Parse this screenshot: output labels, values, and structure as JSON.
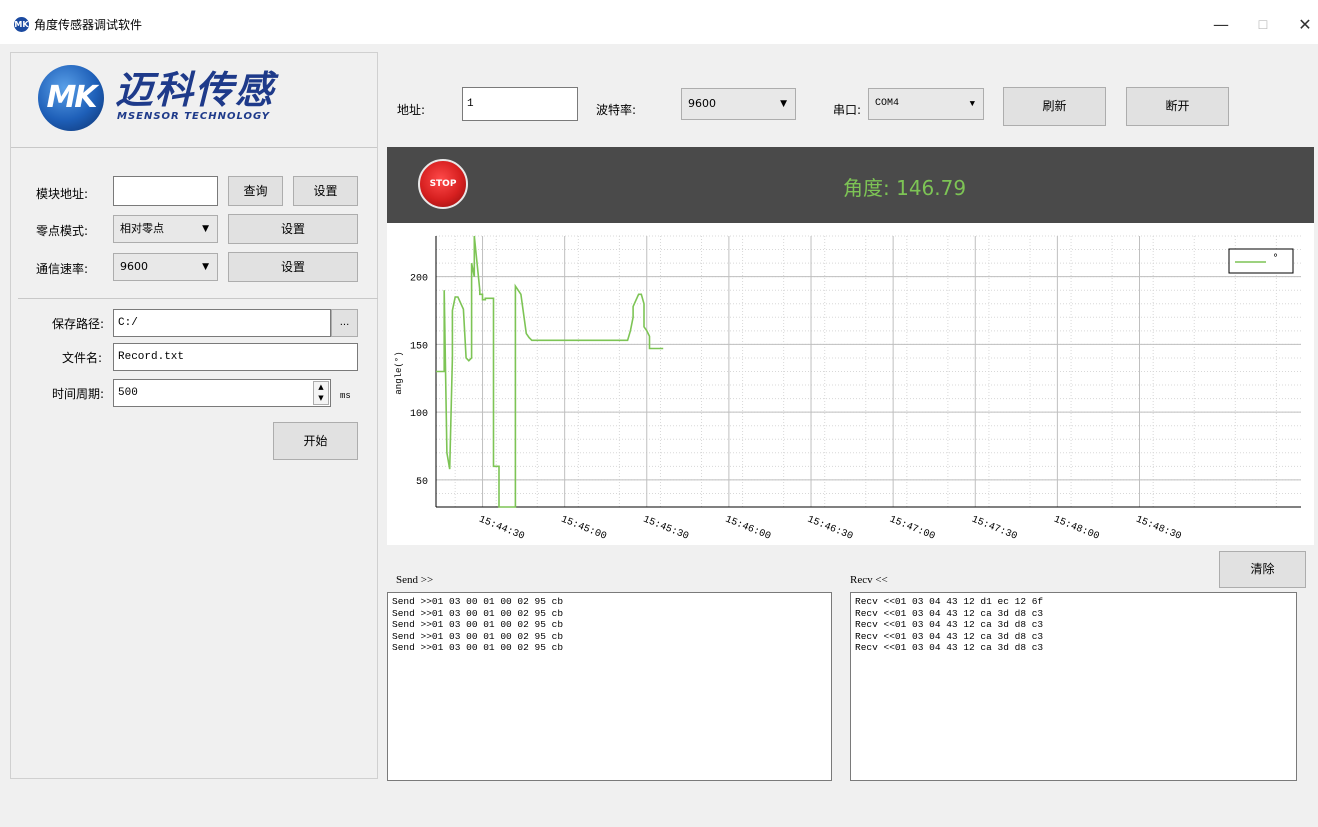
{
  "window": {
    "title": "角度传感器调试软件",
    "icon_text": "MK",
    "minimize": "—",
    "maximize": "☐",
    "close": "✕"
  },
  "logo": {
    "mark": "MK",
    "brand_cn": "迈科传感",
    "brand_en": "MSENSOR TECHNOLOGY"
  },
  "module": {
    "address_label": "模块地址:",
    "address_value": "",
    "query_btn": "查询",
    "set_btn": "设置",
    "zero_label": "零点模式:",
    "zero_value": "相对零点",
    "zero_set_btn": "设置",
    "baud_label": "通信速率:",
    "baud_value": "9600",
    "baud_set_btn": "设置"
  },
  "save": {
    "path_label": "保存路径:",
    "path_value": "C:/",
    "browse_btn": "...",
    "file_label": "文件名:",
    "file_value": "Record.txt",
    "period_label": "时间周期:",
    "period_value": "500",
    "period_unit": "ms",
    "start_btn": "开始"
  },
  "conn": {
    "addr_label": "地址:",
    "addr_value": "1",
    "baud_label": "波特率:",
    "baud_value": "9600",
    "port_label": "串口:",
    "port_value": "COM4",
    "refresh_btn": "刷新",
    "disconnect_btn": "断开"
  },
  "status": {
    "stop_label": "STOP",
    "angle_text": "角度: 146.79",
    "angle_color": "#7dc455"
  },
  "chart_data": {
    "type": "line",
    "ylabel": "angle(°)",
    "ylim": [
      30,
      230
    ],
    "yticks": [
      50,
      100,
      150,
      200
    ],
    "xticks": [
      "15:44:30",
      "15:45:00",
      "15:45:30",
      "15:46:00",
      "15:46:30",
      "15:47:00",
      "15:47:30",
      "15:48:00",
      "15:48:30"
    ],
    "xlim_seconds": [
      -17,
      299
    ],
    "grid": true,
    "legend_position": "top-right",
    "series": [
      {
        "name": "°",
        "color": "#7dc455",
        "x_seconds": [
          -17,
          -14,
          -14,
          -13,
          -12,
          -11,
          -11,
          -10,
          -9,
          -7,
          -6,
          -5,
          -4,
          -4,
          -3,
          -3,
          -1,
          -1,
          0,
          0,
          1,
          1,
          4,
          4,
          6,
          6,
          7,
          8,
          8,
          9,
          10,
          12,
          12,
          14,
          16,
          17,
          18,
          18,
          19,
          19,
          28,
          40,
          48,
          53,
          53,
          54,
          55,
          55,
          57,
          58,
          59,
          59,
          60,
          61,
          61,
          63,
          64,
          66
        ],
        "values": [
          130,
          130,
          190,
          70,
          58,
          140,
          175,
          185,
          185,
          176,
          140,
          138,
          140,
          210,
          200,
          230,
          190,
          187,
          187,
          183,
          183,
          184,
          184,
          60,
          60,
          30,
          30,
          30,
          30,
          30,
          30,
          30,
          193,
          187,
          158,
          155,
          153,
          153,
          153,
          153,
          153,
          153,
          153,
          153,
          153,
          160,
          170,
          178,
          187,
          187,
          180,
          163,
          160,
          156,
          147,
          147,
          147,
          147
        ]
      }
    ]
  },
  "log": {
    "send_header": "Send >>",
    "recv_header": "Recv <<",
    "clear_btn": "清除",
    "send_lines": [
      "Send >>01 03 00 01 00 02 95 cb",
      "Send >>01 03 00 01 00 02 95 cb",
      "Send >>01 03 00 01 00 02 95 cb",
      "Send >>01 03 00 01 00 02 95 cb",
      "Send >>01 03 00 01 00 02 95 cb"
    ],
    "recv_lines": [
      "Recv <<01 03 04 43 12 d1 ec 12 6f",
      "Recv <<01 03 04 43 12 ca 3d d8 c3",
      "Recv <<01 03 04 43 12 ca 3d d8 c3",
      "Recv <<01 03 04 43 12 ca 3d d8 c3",
      "Recv <<01 03 04 43 12 ca 3d d8 c3"
    ]
  }
}
